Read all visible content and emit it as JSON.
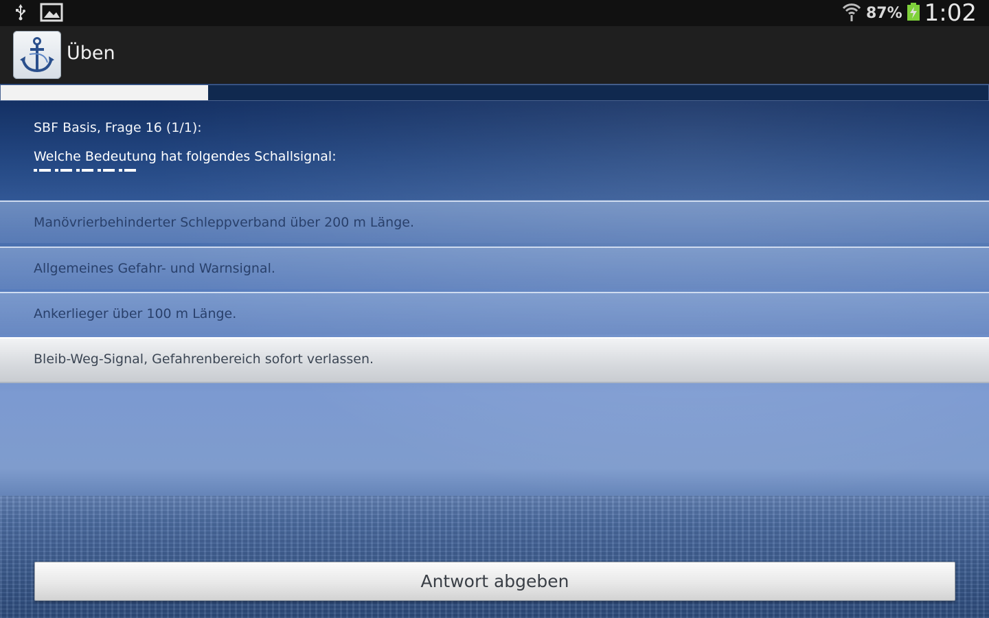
{
  "status_bar": {
    "battery_percent": "87%",
    "time": "1:02",
    "icons": [
      "usb-icon",
      "image-icon",
      "wifi-icon",
      "battery-charging-icon"
    ]
  },
  "action_bar": {
    "title": "Üben",
    "app_icon": "anchor-icon"
  },
  "progress": {
    "fraction": 0.21
  },
  "question": {
    "meta": "SBF Basis, Frage 16 (1/1):",
    "text": "Welche Bedeutung hat folgendes Schallsignal:"
  },
  "answers": [
    {
      "label": "Manövrierbehinderter Schleppverband über 200 m Länge.",
      "selected": false
    },
    {
      "label": "Allgemeines Gefahr- und Warnsignal.",
      "selected": false
    },
    {
      "label": "Ankerlieger über 100 m Länge.",
      "selected": false
    },
    {
      "label": "Bleib-Weg-Signal, Gefahrenbereich sofort verlassen.",
      "selected": true
    }
  ],
  "submit": {
    "label": "Antwort abgeben"
  }
}
